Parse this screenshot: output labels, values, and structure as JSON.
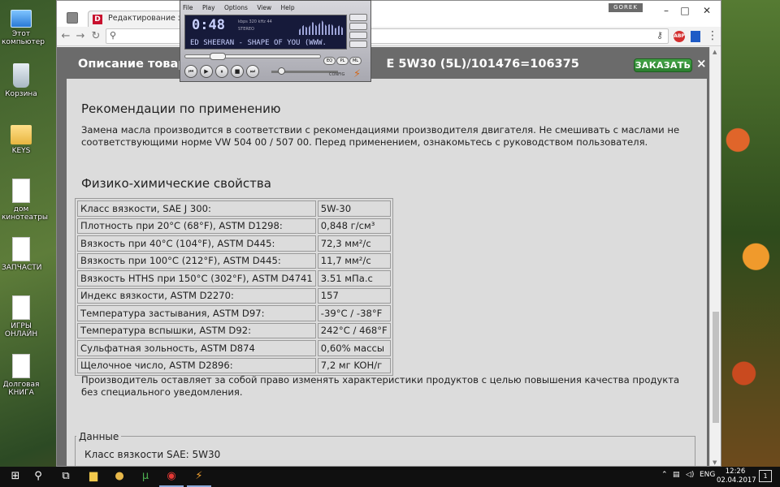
{
  "desktop": {
    "icons": [
      {
        "label": "Этот компьютер"
      },
      {
        "label": "Корзина"
      },
      {
        "label": "KEYS"
      },
      {
        "label": "дом кинотеатры"
      },
      {
        "label": "ЗАПЧАСТИ"
      },
      {
        "label": "ИГРЫ ОНЛАЙН"
      },
      {
        "label": "Долговая КНИГА"
      }
    ]
  },
  "browser": {
    "tab_title": "Редактирование записи",
    "tab_logo": "D",
    "profile_badge": "GOREK",
    "omnibox_value": "",
    "extension_label": "ABP"
  },
  "modal": {
    "title_left": "Описание товара",
    "title_right": "E 5W30 (5L)/101476=106375",
    "order_button": "ЗАКАЗАТЬ",
    "close_symbol": "×"
  },
  "content": {
    "section1_heading": "Рекомендации по применению",
    "section1_text": "Замена масла производится в соответствии с рекомендациями производителя двигателя. Не смешивать с маслами не соответствующими норме VW 504 00 / 507 00. Перед применением, ознакомьтесь с руководством пользователя.",
    "section2_heading": "Физико-химические свойства",
    "properties": [
      {
        "key": "Класс вязкости, SAE J 300:",
        "value": "5W-30"
      },
      {
        "key": "Плотность при 20°C (68°F), ASTM D1298:",
        "value": "0,848 г/см³"
      },
      {
        "key": "Вязкость при 40°C (104°F), ASTM D445:",
        "value": "72,3 мм²/с"
      },
      {
        "key": "Вязкость при 100°C (212°F), ASTM D445:",
        "value": "11,7 мм²/с"
      },
      {
        "key": "Вязкость HTHS при 150°C (302°F), ASTM D4741",
        "value": "3.51 мПа.с"
      },
      {
        "key": "Индекс вязкости, ASTM D2270:",
        "value": "157"
      },
      {
        "key": "Температура застывания, ASTM D97:",
        "value": "-39°C / -38°F"
      },
      {
        "key": "Температура вспышки, ASTM D92:",
        "value": "242°C / 468°F"
      },
      {
        "key": "Сульфатная зольность, ASTM D874",
        "value": "0,60% массы"
      },
      {
        "key": "Щелочное число, ASTM D2896:",
        "value": "7,2 мг KOH/г"
      }
    ],
    "disclaimer": "Производитель оставляет за собой право изменять характеристики продуктов с целью повышения качества продукта без специального уведомления.",
    "data_legend": "Данные",
    "data_line1": "Класс вязкости SAE: 5W30"
  },
  "winamp": {
    "menu": [
      "File",
      "Play",
      "Options",
      "View",
      "Help"
    ],
    "time": "0:48",
    "kbps": "kbps 320 kHz 44",
    "mode": "STEREO",
    "track_scroll": "ED SHEERAN - SHAPE OF YOU (WWW.",
    "small_buttons": [
      "EQ",
      "PL",
      "ML"
    ],
    "config_label": "CONFIG"
  },
  "taskbar": {
    "language": "ENG",
    "time": "12:26",
    "date": "02.04.2017",
    "notification_count": "1"
  }
}
